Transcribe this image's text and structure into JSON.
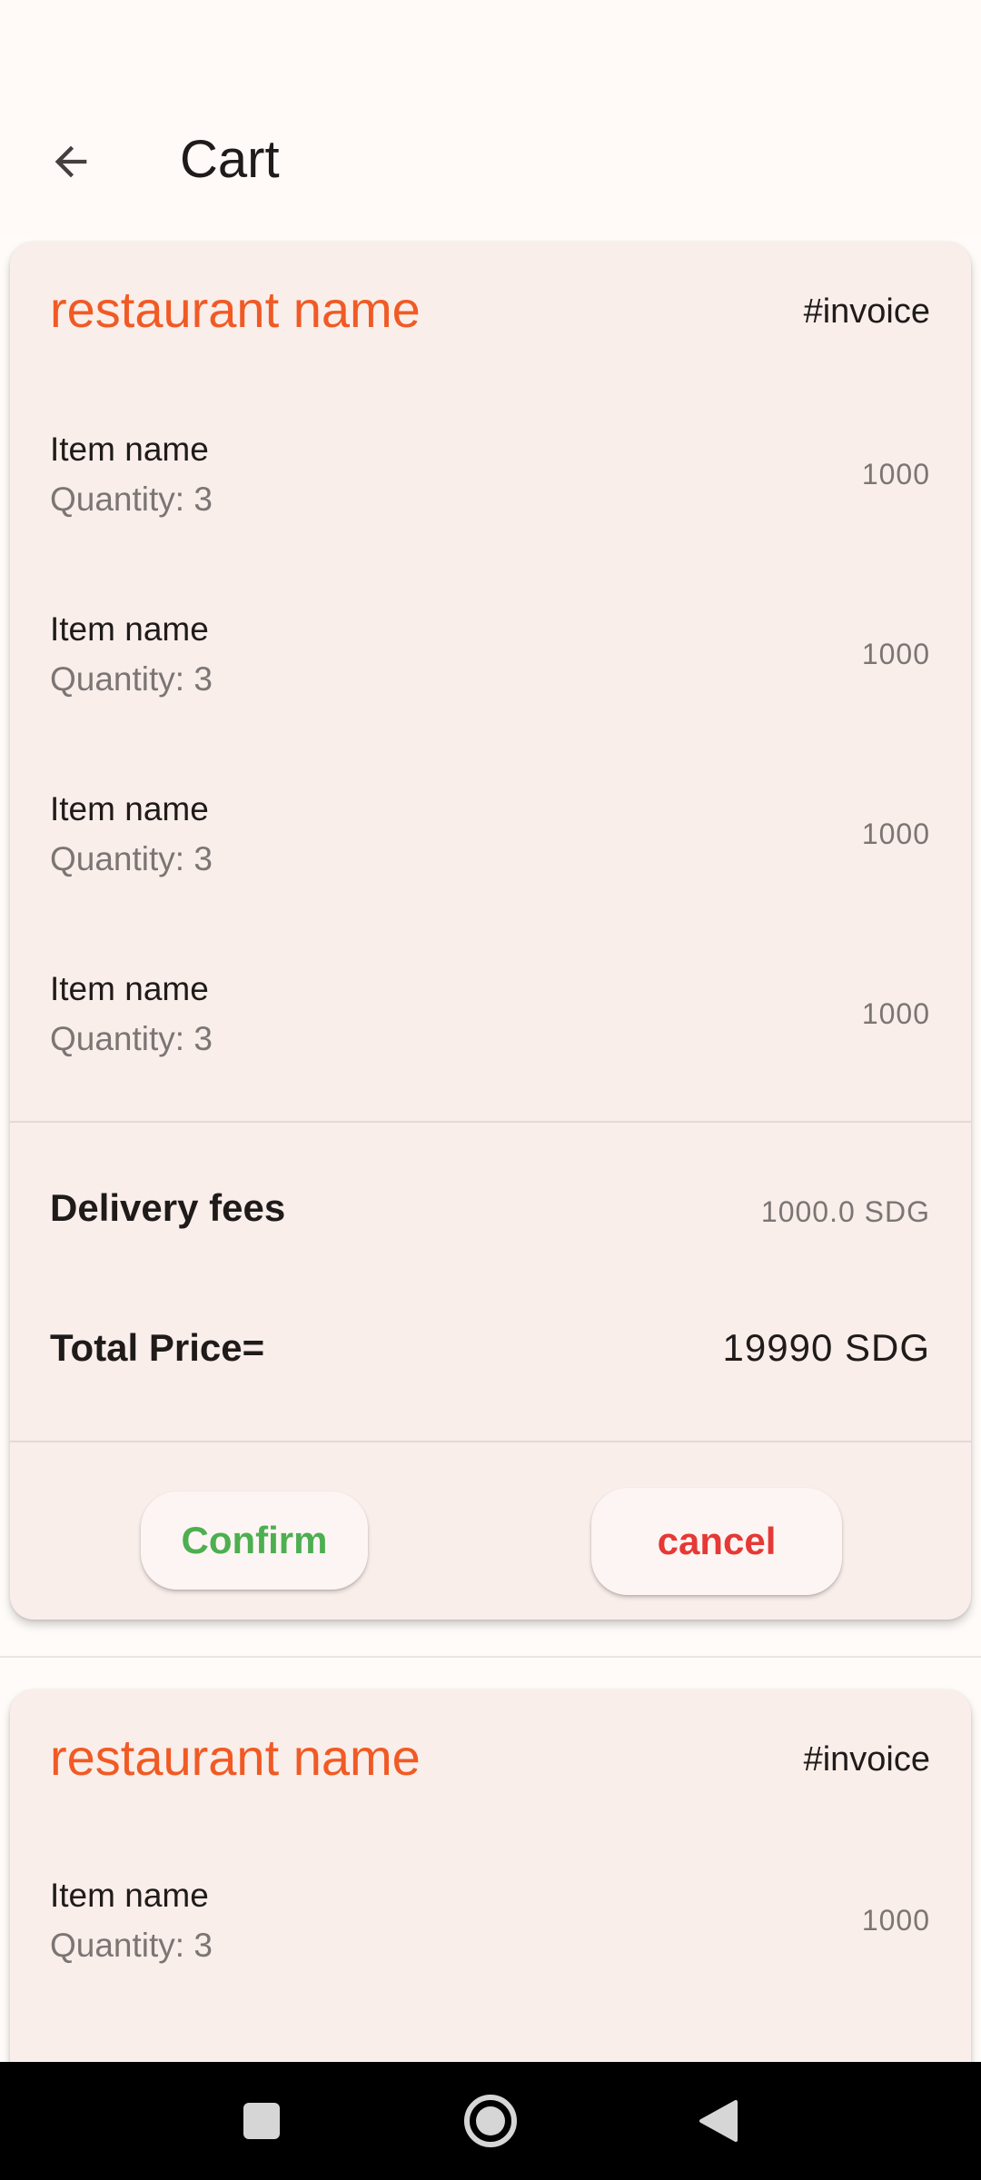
{
  "app_bar": {
    "title": "Cart",
    "back_icon": "arrow-back-icon"
  },
  "cards": [
    {
      "restaurant_name": "restaurant name",
      "invoice": "#invoice",
      "items": [
        {
          "name": "Item name",
          "quantity": "Quantity: 3",
          "price": "1000"
        },
        {
          "name": "Item name",
          "quantity": "Quantity: 3",
          "price": "1000"
        },
        {
          "name": "Item name",
          "quantity": "Quantity: 3",
          "price": "1000"
        },
        {
          "name": "Item name",
          "quantity": "Quantity: 3",
          "price": "1000"
        }
      ],
      "delivery_label": "Delivery fees",
      "delivery_value": "1000.0 SDG",
      "total_label": "Total Price=",
      "total_value": "19990 SDG",
      "confirm_label": "Confirm",
      "cancel_label": "cancel"
    },
    {
      "restaurant_name": "restaurant name",
      "invoice": "#invoice",
      "items": [
        {
          "name": "Item name",
          "quantity": "Quantity: 3",
          "price": "1000"
        }
      ]
    }
  ],
  "colors": {
    "accent": "#f15a24",
    "confirm": "#4caf50",
    "cancel": "#e53935",
    "card_bg": "#f9eeea"
  },
  "system_nav": {
    "recents_icon": "square-recents-icon",
    "home_icon": "circle-home-icon",
    "back_icon": "triangle-back-icon"
  }
}
